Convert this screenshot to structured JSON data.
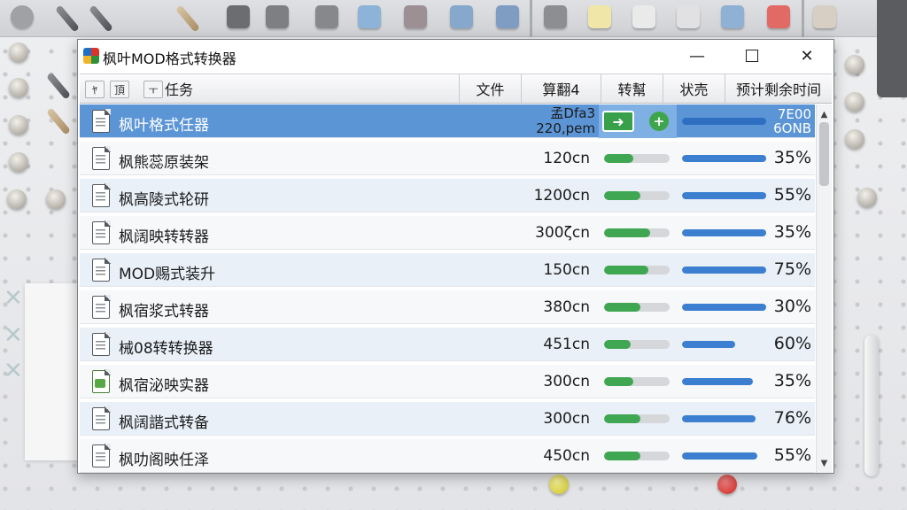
{
  "window": {
    "title": "枫叶MOD格式转换器",
    "controls": {
      "minimize": "—",
      "maximize": "",
      "close": "✕"
    }
  },
  "toolbar": {
    "buttons": [
      "ﾔ",
      "頂",
      "ㅜ"
    ]
  },
  "columns": [
    "任务",
    "文件",
    "算翻4",
    "转幫",
    "状売",
    "预计剩余时间"
  ],
  "rows": [
    {
      "name": "枫叶格式任器",
      "size_line1": "孟Dfa3",
      "size_line2": "220,pem",
      "eta_line1": "7E00",
      "eta_line2": "6ΟΝΒ",
      "progress_blue": 0.95,
      "selected": true,
      "icon": "document-icon"
    },
    {
      "name": "枫熊蕊原装架",
      "size": "120cn",
      "progress_green": 0.45,
      "progress_blue": 0.95,
      "status": "35%",
      "icon": "document-icon"
    },
    {
      "name": "枫高陵式轮研",
      "size": "1200cn",
      "progress_green": 0.55,
      "progress_blue": 0.95,
      "status": "55%",
      "icon": "document-icon"
    },
    {
      "name": "枫阔映转转器",
      "size": "300ζcn",
      "progress_green": 0.7,
      "progress_blue": 0.95,
      "status": "35%",
      "icon": "document-icon"
    },
    {
      "name": "MOD赐式装升",
      "size": "150cn",
      "progress_green": 0.68,
      "progress_blue": 0.95,
      "status": "75%",
      "icon": "document-icon"
    },
    {
      "name": "枫宿浆式转器",
      "size": "380cn",
      "progress_green": 0.55,
      "progress_blue": 0.95,
      "status": "30%",
      "icon": "document-icon"
    },
    {
      "name": "械08转转换器",
      "size": "451cn",
      "progress_green": 0.4,
      "progress_blue": 0.6,
      "status": "60%",
      "icon": "document-icon"
    },
    {
      "name": "枫宿泌映实器",
      "size": "300cn",
      "progress_green": 0.45,
      "progress_blue": 0.8,
      "status": "35%",
      "icon": "spreadsheet-icon"
    },
    {
      "name": "枫阔諧式转备",
      "size": "300cn",
      "progress_green": 0.55,
      "progress_blue": 0.83,
      "status": "76%",
      "icon": "document-icon"
    },
    {
      "name": "枫叻阁映任泽",
      "size": "450cn",
      "progress_green": 0.55,
      "progress_blue": 0.85,
      "status": "55%",
      "icon": "document-icon"
    }
  ],
  "selected_row_actions": {
    "convert": "➜",
    "add": "+"
  },
  "scrollbar": {
    "up": "▲",
    "down": "▼"
  },
  "colors": {
    "selection": "#5b95d6",
    "progress_green": "#3fa651",
    "progress_blue": "#3c7fd1"
  }
}
